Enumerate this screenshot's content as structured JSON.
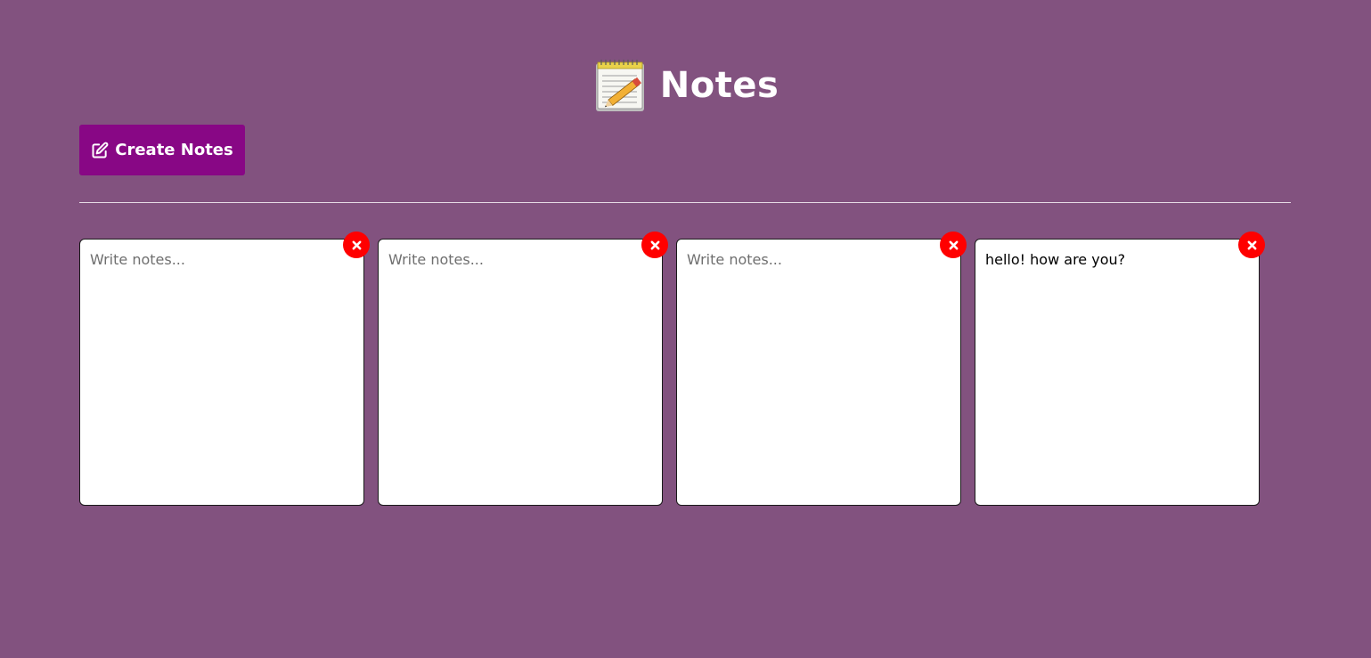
{
  "header": {
    "icon": "notepad-pencil-icon",
    "title": "Notes"
  },
  "toolbar": {
    "create_label": "Create Notes",
    "create_icon": "edit-icon"
  },
  "notes": {
    "placeholder": "Write notes...",
    "delete_icon": "close-icon",
    "items": [
      {
        "value": ""
      },
      {
        "value": ""
      },
      {
        "value": ""
      },
      {
        "value": "hello! how are you?"
      }
    ]
  },
  "colors": {
    "background": "#82527f",
    "button": "#880785",
    "delete": "#ff0000"
  }
}
